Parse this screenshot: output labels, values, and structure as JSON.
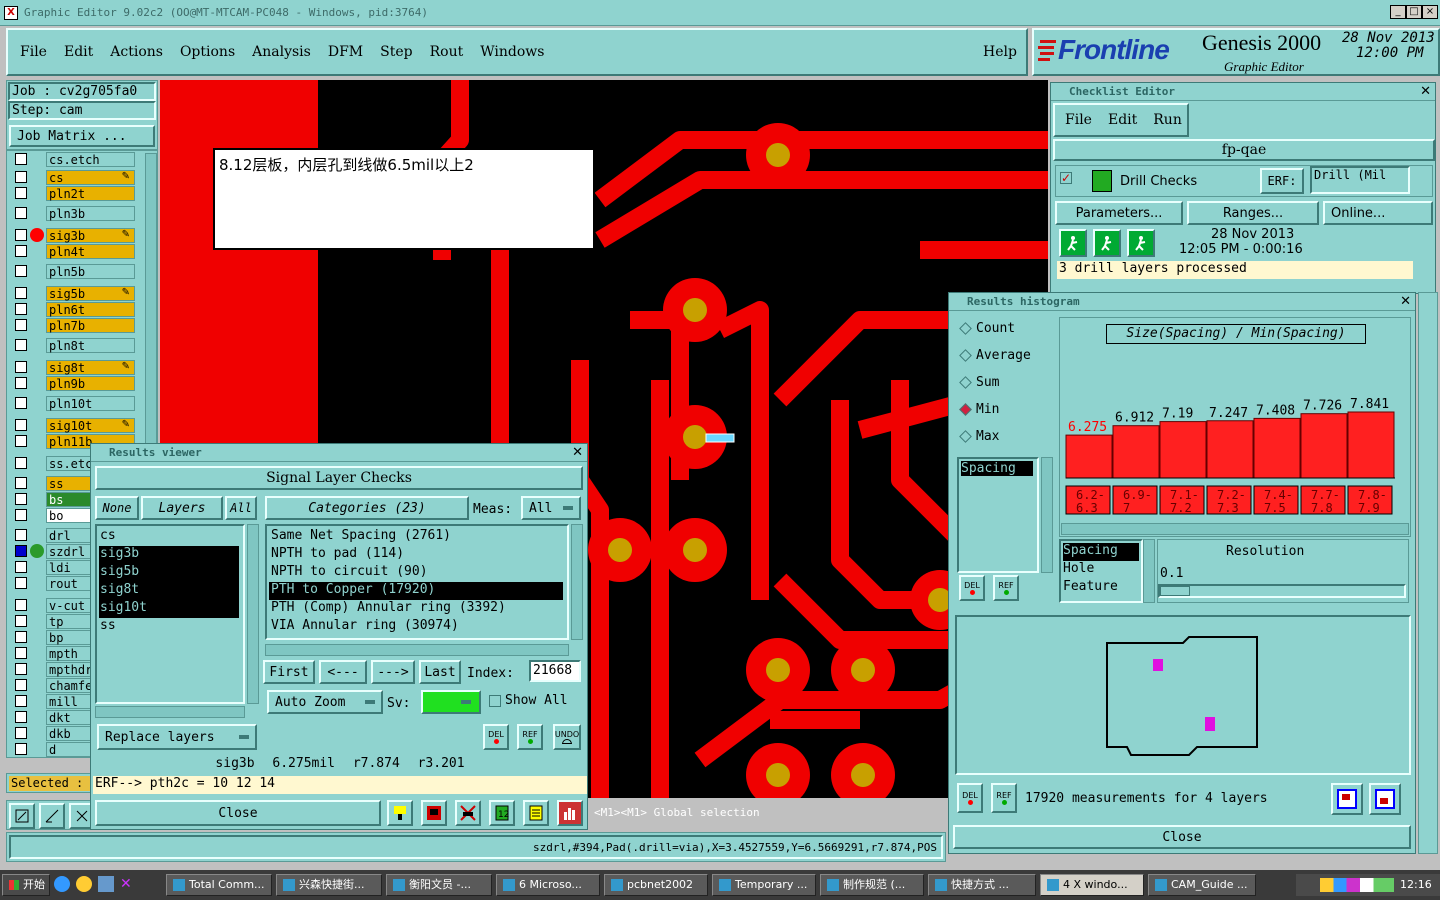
{
  "window": {
    "title": "Graphic Editor 9.02c2 (OO@MT-MTCAM-PC048 - Windows, pid:3764)"
  },
  "menu": [
    "File",
    "Edit",
    "Actions",
    "Options",
    "Analysis",
    "DFM",
    "Step",
    "Rout",
    "Windows"
  ],
  "help": "Help",
  "brand": {
    "name": "Frontline",
    "product": "Genesis 2000",
    "sub": "Graphic Editor",
    "date": "28 Nov 2013",
    "time": "12:00 PM"
  },
  "job": {
    "job": "Job : cv2g705fa0",
    "step": "Step: cam",
    "matrix": "Job Matrix ..."
  },
  "layers": [
    {
      "name": "cs.etch",
      "color": "#8fd3cf"
    },
    {
      "name": "cs",
      "color": "#e8b100",
      "mark": true
    },
    {
      "name": "pln2t",
      "color": "#e8b100"
    },
    {
      "name": "pln3b",
      "color": "#8fd3cf"
    },
    {
      "name": "sig3b",
      "color": "#e8b100",
      "mark": true,
      "dot": "#f00"
    },
    {
      "name": "pln4t",
      "color": "#e8b100"
    },
    {
      "name": "pln5b",
      "color": "#8fd3cf"
    },
    {
      "name": "sig5b",
      "color": "#e8b100",
      "mark": true
    },
    {
      "name": "pln6t",
      "color": "#e8b100"
    },
    {
      "name": "pln7b",
      "color": "#e8b100"
    },
    {
      "name": "pln8t",
      "color": "#8fd3cf"
    },
    {
      "name": "sig8t",
      "color": "#e8b100",
      "mark": true
    },
    {
      "name": "pln9b",
      "color": "#e8b100"
    },
    {
      "name": "pln10t",
      "color": "#8fd3cf"
    },
    {
      "name": "sig10t",
      "color": "#e8b100",
      "mark": true
    },
    {
      "name": "pln11b",
      "color": "#e8b100"
    },
    {
      "name": "ss.etch",
      "color": "#8fd3cf"
    },
    {
      "name": "ss",
      "color": "#e8b100"
    },
    {
      "name": "bs",
      "color": "#2b8a2b"
    },
    {
      "name": "bo",
      "color": "#fff"
    },
    {
      "name": "drl",
      "color": "#8fd3cf"
    },
    {
      "name": "szdrl",
      "color": "#8fd3cf",
      "dot": "#2b9a2b",
      "checked": true
    },
    {
      "name": "ldi",
      "color": "#8fd3cf"
    },
    {
      "name": "rout",
      "color": "#8fd3cf"
    },
    {
      "name": "v-cut",
      "color": "#8fd3cf"
    },
    {
      "name": "tp",
      "color": "#8fd3cf"
    },
    {
      "name": "bp",
      "color": "#8fd3cf"
    },
    {
      "name": "mpth",
      "color": "#8fd3cf"
    },
    {
      "name": "mpthdr",
      "color": "#8fd3cf"
    },
    {
      "name": "chamfe",
      "color": "#8fd3cf"
    },
    {
      "name": "mill",
      "color": "#8fd3cf"
    },
    {
      "name": "dkt",
      "color": "#8fd3cf"
    },
    {
      "name": "dkb",
      "color": "#8fd3cf"
    },
    {
      "name": "d",
      "color": "#8fd3cf"
    }
  ],
  "selected": "Selected :",
  "note": "8.12层板，内层孔到线做6.5mil以上2",
  "status": {
    "message": "<M1><M1> Global selection",
    "coords": "szdrl,#394,Pad(.drill=via),X=3.4527559,Y=6.5669291,r7.874,POS"
  },
  "results_viewer": {
    "title": "Results viewer",
    "header": "Signal Layer Checks",
    "none": "None",
    "layers_btn": "Layers",
    "all": "All",
    "layer_list": [
      "cs",
      "sig3b",
      "sig5b",
      "sig8t",
      "sig10t",
      "ss"
    ],
    "categories_label": "Categories (23)",
    "meas_label": "Meas:",
    "meas_value": "All",
    "categories": [
      "Same Net Spacing (2761)",
      "NPTH to pad (114)",
      "NPTH to circuit (90)",
      "PTH to Copper (17920)",
      "PTH (Comp) Annular ring (3392)",
      "VIA Annular ring (30974)"
    ],
    "nav": {
      "first": "First",
      "prev": "<---",
      "next": "--->",
      "last": "Last",
      "index_label": "Index:",
      "index": "21668"
    },
    "auto_zoom": "Auto Zoom",
    "sv": "Sv:",
    "show_all": "Show All",
    "replace": "Replace layers",
    "del": "DEL",
    "ref": "REF",
    "undo": "UNDO",
    "info": "sig3b 6.275mil r7.874 r3.201",
    "erf": "ERF--> pth2c = 10 12 14",
    "close": "Close"
  },
  "checklist": {
    "title": "Checklist Editor",
    "menu": [
      "File",
      "Edit",
      "Run"
    ],
    "name": "fp-qae",
    "drill": "Drill Checks",
    "erf": "ERF:",
    "erf_value": "Drill (Mil",
    "params": "Parameters...",
    "ranges": "Ranges...",
    "online": "Online...",
    "date": "28 Nov 2013",
    "time": "12:05 PM - 0:00:16",
    "processed": "3 drill layers processed"
  },
  "histogram": {
    "title": "Results histogram",
    "options": [
      "Count",
      "Average",
      "Sum",
      "Min",
      "Max"
    ],
    "selected": "Min",
    "metric_list": [
      "Spacing"
    ],
    "chart_title": "Size(Spacing) / Min(Spacing)",
    "res_list": [
      "Spacing",
      "Hole",
      "Feature"
    ],
    "resolution_label": "Resolution",
    "resolution": "0.1",
    "del": "DEL",
    "ref": "REF",
    "summary": "17920 measurements for 4 layers",
    "close": "Close"
  },
  "chart_data": {
    "type": "bar",
    "categories": [
      "6.2-6.3",
      "6.9-7",
      "7.1-7.2",
      "7.2-7.3",
      "7.4-7.5",
      "7.7-7.8",
      "7.8-7.9"
    ],
    "values": [
      6.275,
      6.912,
      7.19,
      7.247,
      7.408,
      7.726,
      7.841
    ],
    "labels": [
      "6.275",
      "6.912",
      "7.19",
      "7.247",
      "7.408",
      "7.726",
      "7.841"
    ],
    "title": "Size(Spacing) / Min(Spacing)",
    "color": "#ff2020"
  },
  "taskbar": {
    "start": "开始",
    "items": [
      "Total Comm...",
      "兴森快捷街...",
      "衡阳文员 -...",
      "6 Microso...",
      "pcbnet2002",
      "Temporary ...",
      "制作规范 (...",
      "快捷方式 ...",
      "4 X windo...",
      "CAM_Guide ..."
    ],
    "clock": "12:16"
  }
}
